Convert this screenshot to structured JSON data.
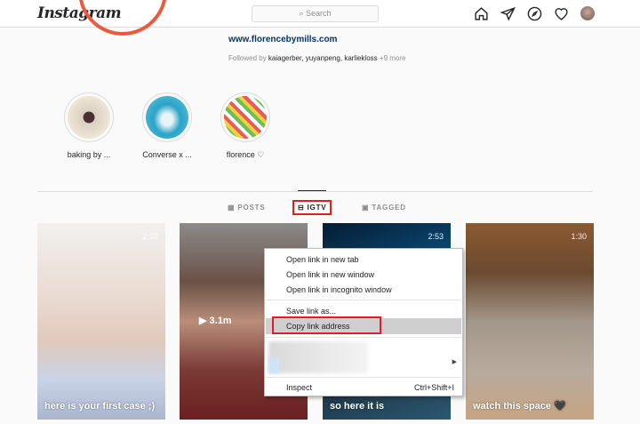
{
  "header": {
    "logo": "Instagram",
    "search_placeholder": "Search",
    "search_icon": "magnifier"
  },
  "profile": {
    "website": "www.florencebymills.com",
    "followed_prefix": "Followed by ",
    "followed_names": "kaiagerber, yuyanpeng, karliekloss",
    "followed_more": " +9 more"
  },
  "highlights": [
    {
      "label": "baking by ..."
    },
    {
      "label": "Converse x ..."
    },
    {
      "label": "florence ♡"
    }
  ],
  "tabs": [
    {
      "label": "POSTS"
    },
    {
      "label": "IGTV"
    },
    {
      "label": "TAGGED"
    }
  ],
  "videos": [
    {
      "caption": "here is your first case ;)",
      "duration": "2:59"
    },
    {
      "caption": "",
      "views": "3.1m"
    },
    {
      "caption": "so here it is",
      "duration": "2:53"
    },
    {
      "caption": "watch this space 🖤",
      "duration": "1:30"
    }
  ],
  "context_menu": {
    "items": [
      "Open link in new tab",
      "Open link in new window",
      "Open link in incognito window",
      "Save link as...",
      "Copy link address",
      "Inspect"
    ],
    "inspect_shortcut": "Ctrl+Shift+I",
    "highlighted": "Copy link address"
  },
  "colors": {
    "highlight_box": "#e02020",
    "link": "#00376b"
  }
}
